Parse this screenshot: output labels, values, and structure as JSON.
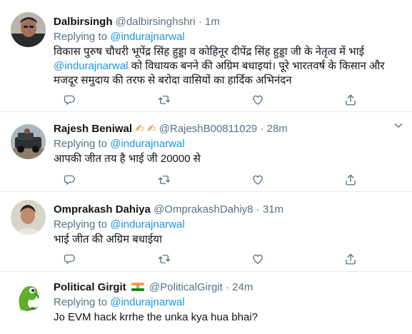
{
  "tweets": [
    {
      "name": "Dalbirsingh",
      "handle": "@dalbirsinghshri",
      "time": "1m",
      "replying_prefix": "Replying to ",
      "replying_to": "@indurajnarwal",
      "line1": "विकास पुरुष चौधरी भूपेंद्र सिंह हुड्डा व कोहिनूर दीपेंद्र सिंह हुड्डा जी के नेतृत्व में भाई",
      "mention_inline": "@indurajnarwal",
      "line2_rest": " को विधायक बनने की अग्रिम बधाइयां। पूरे भारतवर्ष के किसान और",
      "line3": "मजदूर समुदाय की तरफ से  बरोदा वासियों का हार्दिक अभिनंदन"
    },
    {
      "name": "Rajesh Beniwal",
      "emoji": "✍ ✍",
      "handle": "@RajeshB00811029",
      "time": "28m",
      "replying_prefix": "Replying to ",
      "replying_to": "@indurajnarwal",
      "text": "आपकी जीत तय है भाई जी 20000 से"
    },
    {
      "name": "Omprakash Dahiya",
      "handle": "@OmprakashDahiy8",
      "time": "31m",
      "replying_prefix": "Replying to ",
      "replying_to": "@indurajnarwal",
      "text": "भाई जीत की अग्रिम बधाईया"
    },
    {
      "name": "Political Girgit",
      "handle": "@PoliticalGirgit",
      "time": "24m",
      "replying_prefix": "Replying to ",
      "replying_to": "@indurajnarwal",
      "text": "Jo EVM hack krrhe the unka kya hua bhai?"
    }
  ],
  "separator": "·",
  "icons": [
    "reply-icon",
    "retweet-icon",
    "like-icon",
    "share-icon",
    "chevron-down-icon"
  ],
  "colors": {
    "link": "#1b95e0",
    "secondary": "#5b7083",
    "border": "#e6ecf0"
  }
}
